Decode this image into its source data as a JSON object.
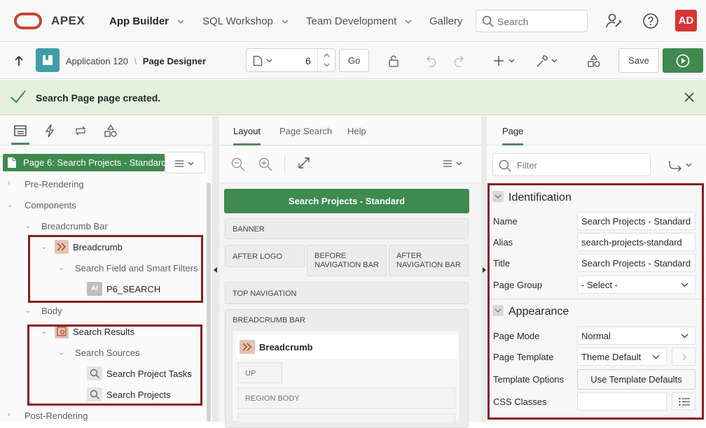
{
  "topnav": {
    "brand": "APEX",
    "menus": [
      {
        "label": "App Builder"
      },
      {
        "label": "SQL Workshop"
      },
      {
        "label": "Team Development"
      },
      {
        "label": "Gallery"
      }
    ],
    "search_placeholder": "Search",
    "avatar_initials": "AD",
    "brand_color": "#c74634"
  },
  "toolbar": {
    "breadcrumb_app": "Application 120",
    "breadcrumb_page": "Page Designer",
    "page_number": "6",
    "go_label": "Go",
    "save_label": "Save"
  },
  "alert": {
    "message": "Search Page page created."
  },
  "left": {
    "page_title": "Page 6: Search Projects - Standard",
    "tree": {
      "pre_rendering": "Pre-Rendering",
      "components": "Components",
      "breadcrumb_bar": "Breadcrumb Bar",
      "breadcrumb": "Breadcrumb",
      "search_field_filters": "Search Field and Smart Filters",
      "p6_search": "P6_SEARCH",
      "body": "Body",
      "search_results": "Search Results",
      "search_sources": "Search Sources",
      "search_project_tasks": "Search Project Tasks",
      "search_projects": "Search Projects",
      "post_rendering": "Post-Rendering"
    }
  },
  "middle": {
    "tabs": [
      "Layout",
      "Page Search",
      "Help"
    ],
    "page_banner": "Search Projects - Standard",
    "regions": {
      "banner": "BANNER",
      "after_logo": "AFTER LOGO",
      "before_nav_1": "BEFORE",
      "before_nav_2": "NAVIGATION BAR",
      "after_nav_1": "AFTER",
      "after_nav_2": "NAVIGATION BAR",
      "top_navigation": "TOP NAVIGATION",
      "breadcrumb_bar": "BREADCRUMB BAR",
      "breadcrumb": "Breadcrumb",
      "up": "UP",
      "region_body": "REGION BODY"
    }
  },
  "right": {
    "tab": "Page",
    "filter_placeholder": "Filter",
    "identification": {
      "header": "Identification",
      "name_label": "Name",
      "name_value": "Search Projects - Standard",
      "alias_label": "Alias",
      "alias_value": "search-projects-standard",
      "title_label": "Title",
      "title_value": "Search Projects - Standard",
      "page_group_label": "Page Group",
      "page_group_value": "- Select -"
    },
    "appearance": {
      "header": "Appearance",
      "page_mode_label": "Page Mode",
      "page_mode_value": "Normal",
      "page_template_label": "Page Template",
      "page_template_value": "Theme Default",
      "template_options_label": "Template Options",
      "template_options_button": "Use Template Defaults",
      "css_classes_label": "CSS Classes"
    }
  }
}
